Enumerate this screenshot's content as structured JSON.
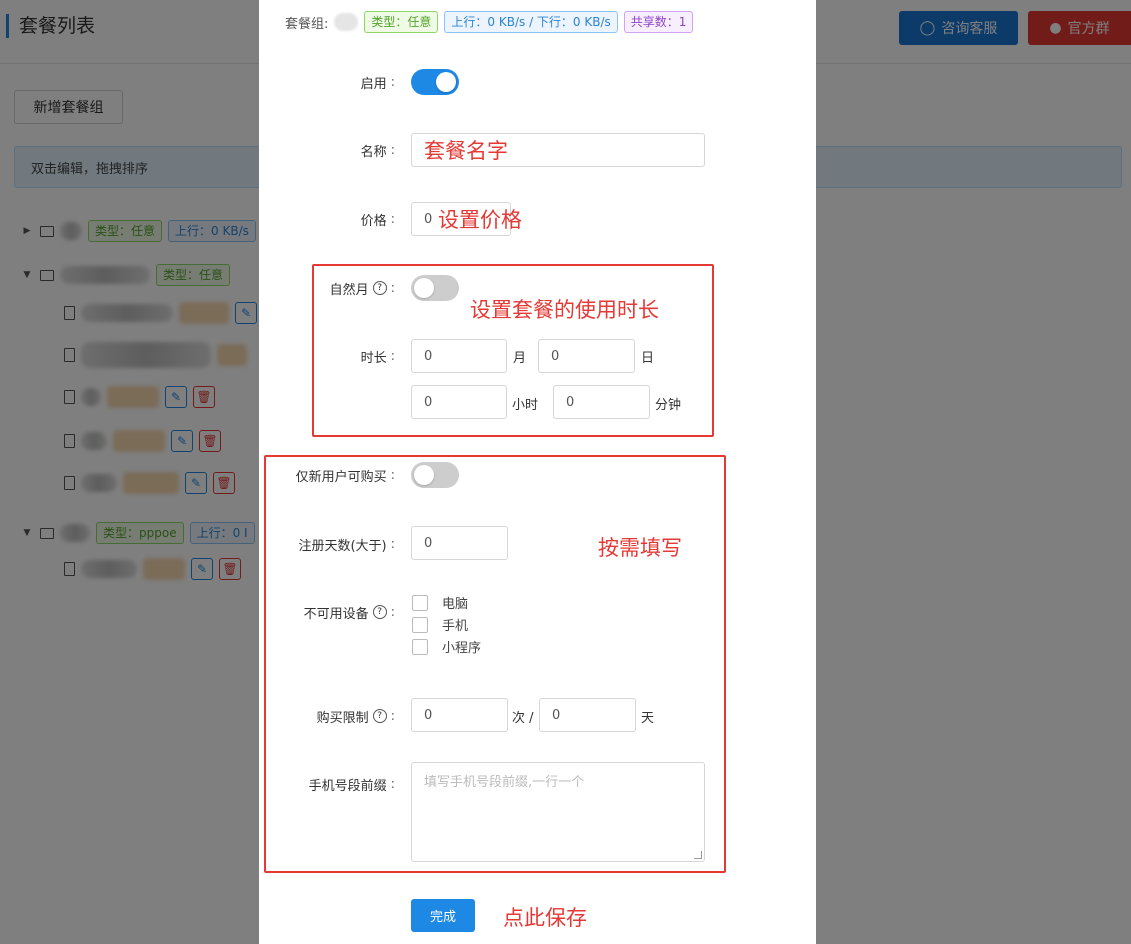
{
  "page": {
    "title": "套餐列表",
    "consult_btn": "咨询客服",
    "group_btn": "官方群",
    "new_group_btn": "新增套餐组",
    "tip": "双击编辑，拖拽排序"
  },
  "tree": {
    "tag_type_any": "类型：任意",
    "tag_rate_partial": "上行：0 KB/s",
    "tag_type_pppoe": "类型：pppoe",
    "tag_rate_short": "上行：0 I"
  },
  "modal": {
    "group_label": "套餐组:",
    "tag_type": "类型：任意",
    "tag_rate": "上行：0 KB/s / 下行：0 KB/s",
    "tag_share": "共享数：1",
    "enable_label": "启用",
    "name_label": "名称",
    "price_label": "价格",
    "price_value": "0",
    "natural_month_label": "自然月",
    "duration_label": "时长",
    "month_value": "0",
    "month_unit": "月",
    "day_value": "0",
    "day_unit": "日",
    "hour_value": "0",
    "hour_unit": "小时",
    "minute_value": "0",
    "minute_unit": "分钟",
    "new_user_only_label": "仅新用户可购买",
    "reg_days_label": "注册天数(大于)",
    "reg_days_value": "0",
    "unavailable_devices_label": "不可用设备",
    "devices": [
      "电脑",
      "手机",
      "小程序"
    ],
    "purchase_limit_label": "购买限制",
    "limit_times_value": "0",
    "limit_times_unit": "次 /",
    "limit_days_value": "0",
    "limit_days_unit": "天",
    "phone_prefix_label": "手机号段前缀",
    "phone_prefix_placeholder": "填写手机号段前缀,一行一个",
    "done_btn": "完成"
  },
  "annotations": {
    "name": "套餐名字",
    "price": "设置价格",
    "duration": "设置套餐的使用时长",
    "optional": "按需填写",
    "save": "点此保存"
  },
  "colors": {
    "primary": "#1e88e5",
    "danger": "#e53935",
    "annotation": "#e53935"
  }
}
